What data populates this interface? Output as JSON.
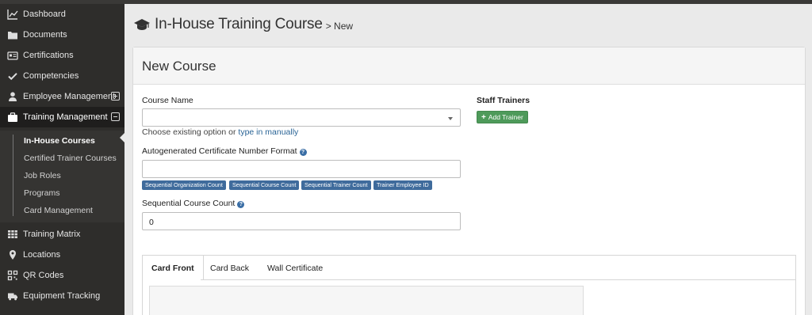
{
  "sidebar": {
    "items": [
      {
        "label": "Dashboard"
      },
      {
        "label": "Documents"
      },
      {
        "label": "Certifications"
      },
      {
        "label": "Competencies"
      },
      {
        "label": "Employee Management"
      },
      {
        "label": "Training Management"
      },
      {
        "label": "Training Matrix"
      },
      {
        "label": "Locations"
      },
      {
        "label": "QR Codes"
      },
      {
        "label": "Equipment Tracking"
      }
    ],
    "subitems": [
      {
        "label": "In-House Courses"
      },
      {
        "label": "Certified Trainer Courses"
      },
      {
        "label": "Job Roles"
      },
      {
        "label": "Programs"
      },
      {
        "label": "Card Management"
      }
    ]
  },
  "header": {
    "title": "In-House Training Course",
    "crumb": "> New"
  },
  "panel": {
    "title": "New Course"
  },
  "form": {
    "course_name_label": "Course Name",
    "course_name_value": "",
    "hint_prefix": "Choose existing option or",
    "hint_link": "type in manually",
    "cert_format_label": "Autogenerated Certificate Number Format",
    "cert_format_value": "",
    "tags": [
      "Sequential Organization Count",
      "Sequential Course Count",
      "Sequential Trainer Count",
      "Trainer Employee ID"
    ],
    "seq_label": "Sequential Course Count",
    "seq_value": "0",
    "help_glyph": "?"
  },
  "trainers": {
    "title": "Staff Trainers",
    "add_label": "Add Trainer"
  },
  "tabs": [
    "Card Front",
    "Card Back",
    "Wall Certificate"
  ],
  "colors": {
    "sidebar_bg": "#2e2d2b",
    "link": "#2a6496",
    "tag_bg": "#3f6b9c",
    "add_btn": "#4e9a5a"
  }
}
